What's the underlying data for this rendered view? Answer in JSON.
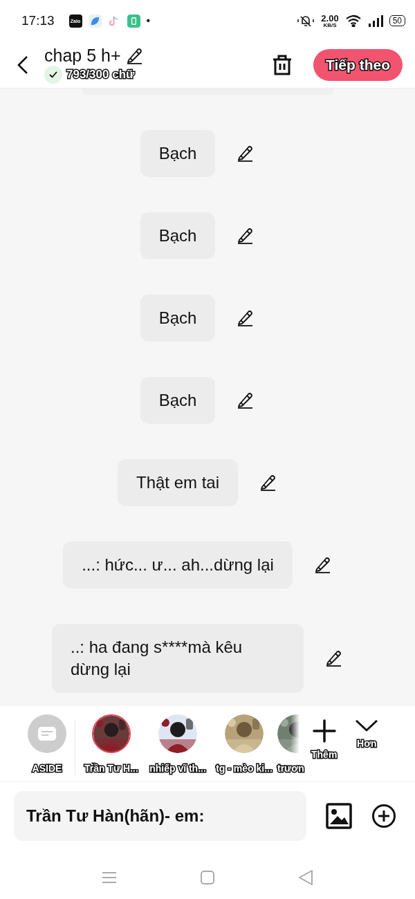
{
  "status_bar": {
    "time": "17:13",
    "app_icons": [
      {
        "kind": "zalo",
        "label": "Zalo"
      },
      {
        "kind": "leaf"
      },
      {
        "kind": "tiktok"
      },
      {
        "kind": "battery-app"
      }
    ],
    "more_dot": "•",
    "speed": "2.00",
    "speed_unit": "KB/S",
    "battery": "50"
  },
  "header": {
    "title": "chap 5 h+",
    "word_count": "793/300 chữ",
    "word_count_ok": true,
    "next_button": "Tiếp theo"
  },
  "messages": [
    {
      "text": "Bạch"
    },
    {
      "text": "Bạch"
    },
    {
      "text": "Bạch"
    },
    {
      "text": "Bạch"
    },
    {
      "text": "Thật em tai"
    },
    {
      "text": "...: hức... ư... ah...dừng lại"
    },
    {
      "text": "..: ha đang s****mà kêu dừng lại"
    }
  ],
  "characters": [
    {
      "kind": "aside",
      "name": "ASIDE",
      "selected": false
    },
    {
      "kind": "character",
      "name": "Trần Tư H...",
      "selected": true
    },
    {
      "kind": "character",
      "name": "nhiếp vĩ th...",
      "selected": false
    },
    {
      "kind": "character",
      "name": "tg - mèo ki...",
      "selected": false
    },
    {
      "kind": "character",
      "name": "trươn",
      "selected": false
    }
  ],
  "strip_actions": [
    {
      "kind": "add",
      "label": "Thêm"
    },
    {
      "kind": "more",
      "label": "Hơn"
    }
  ],
  "compose": {
    "value": "Trần Tư Hàn(hãn)- em:"
  }
}
